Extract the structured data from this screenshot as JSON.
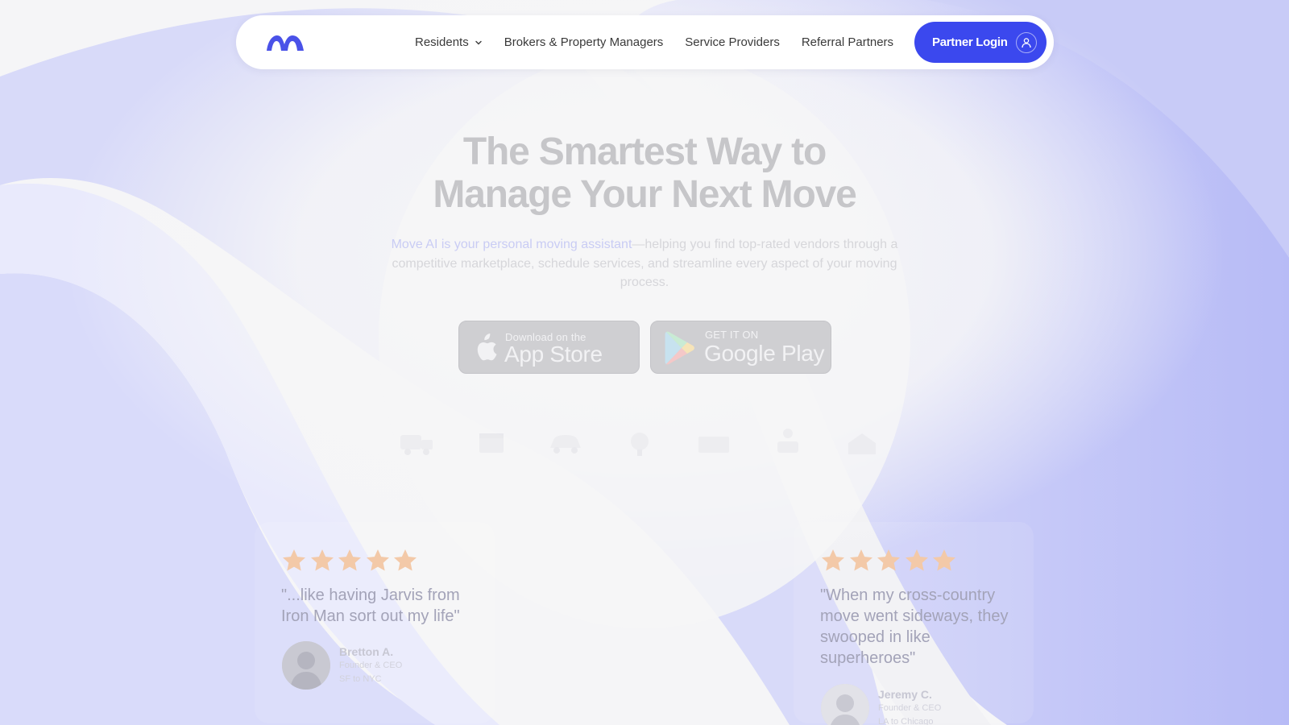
{
  "nav": {
    "items": [
      {
        "label": "Residents",
        "has_dropdown": true
      },
      {
        "label": "Brokers & Property Managers",
        "has_dropdown": false
      },
      {
        "label": "Service Providers",
        "has_dropdown": false
      },
      {
        "label": "Referral Partners",
        "has_dropdown": false
      }
    ],
    "login_label": "Partner Login",
    "logo_icon": "move-ai-logo-icon",
    "user_icon": "user-icon"
  },
  "hero": {
    "headline_line1": "The Smartest Way to",
    "headline_line2": "Manage Your Next Move",
    "sub_highlight": "Move AI is your personal moving assistant",
    "sub_rest": "—helping you find top-rated vendors through a competitive marketplace, schedule services, and streamline every aspect of your moving process."
  },
  "stores": {
    "apple_small": "Download on the",
    "apple_big": "App Store",
    "google_small": "GET IT ON",
    "google_big": "Google Play"
  },
  "testimonials": [
    {
      "quote": "\"...like having Jarvis from Iron Man sort out my life\"",
      "name": "Bretton A.",
      "role": "Founder & CEO",
      "route": "SF to NYC",
      "rating": 5
    },
    {
      "quote": "\"When my cross-country move went sideways, they swooped in like superheroes\"",
      "name": "Jeremy C.",
      "role": "Founder & CEO",
      "route": "LA to Chicago",
      "rating": 5
    }
  ],
  "colors": {
    "accent": "#3b48ee",
    "logo": "#4a52e8",
    "star": "#f3c9a8",
    "wave": "#c2c5f7"
  }
}
